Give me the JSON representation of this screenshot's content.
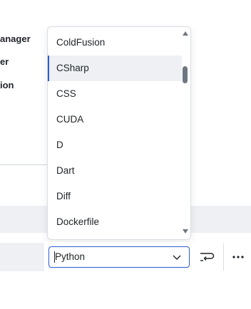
{
  "background": {
    "labels": [
      "anager",
      "er",
      "ion"
    ]
  },
  "language_dropdown": {
    "options": [
      "ColdFusion",
      "CSharp",
      "CSS",
      "CUDA",
      "D",
      "Dart",
      "Diff",
      "Dockerfile"
    ],
    "highlighted": "CSharp"
  },
  "language_select": {
    "value": "Python"
  },
  "toolbar": {
    "wrap_icon": "word-wrap-icon",
    "more_icon": "more-horizontal-icon"
  },
  "colors": {
    "accent": "#2f5bd0",
    "highlight_bg": "#eef0f3",
    "border": "#d8dee4"
  }
}
